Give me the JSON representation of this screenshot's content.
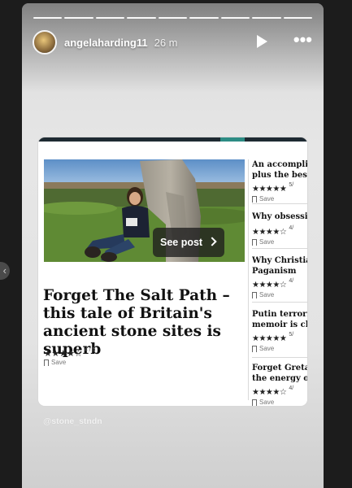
{
  "story": {
    "username": "angelaharding11",
    "time_ago": "26 m",
    "progress_segments": 9,
    "more_label": "•••",
    "see_post_label": "See post",
    "mention": "@stone_stndn"
  },
  "main_article": {
    "title": "Forget The Salt Path – this tale of Britain's ancient stone sites is superb",
    "stars": "★★★★☆",
    "score": "4 / 5",
    "save_label": "Save"
  },
  "side_articles": [
    {
      "title_lines": [
        "An accomplis",
        "plus the best"
      ],
      "stars": "★★★★★",
      "score": "5/",
      "save_label": "Save"
    },
    {
      "title_lines": [
        "Why obsessin"
      ],
      "stars": "★★★★☆",
      "score": "4/",
      "save_label": "Save"
    },
    {
      "title_lines": [
        "Why Christia",
        "Paganism"
      ],
      "stars": "★★★★☆",
      "score": "4/",
      "save_label": "Save"
    },
    {
      "title_lines": [
        "Putin terroris",
        "memoir is chi"
      ],
      "stars": "★★★★★",
      "score": "5/",
      "save_label": "Save"
    },
    {
      "title_lines": [
        "Forget Greta",
        "the energy of"
      ],
      "stars": "★★★★☆",
      "score": "4/",
      "save_label": "Save"
    }
  ],
  "colors": {
    "story_bg": "#e3e3e3",
    "card_header": "#1e2a32",
    "accent": "#2d8c84"
  }
}
